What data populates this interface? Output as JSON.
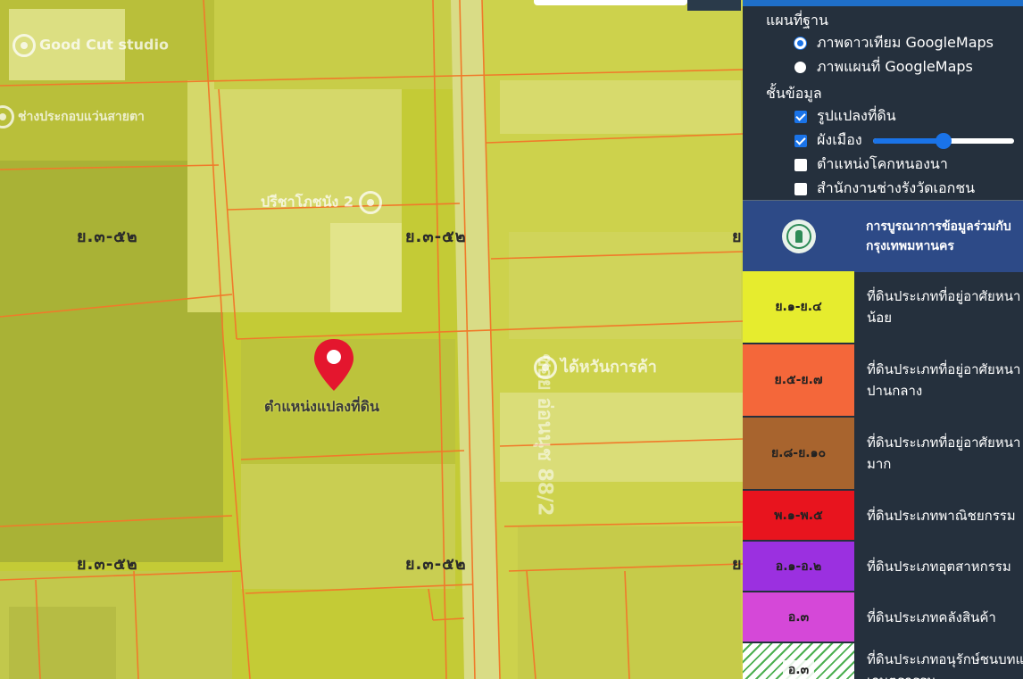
{
  "map": {
    "zone_labels": [
      "ย.๓-๕๒",
      "ย.๓-๕๒",
      "ย.๓-๕๒",
      "ย.๓-๕๒",
      "ย",
      "ย"
    ],
    "pois": [
      "Good Cut studio",
      "ช่างประกอบแว่นสายตา",
      "ปรีชาโภชนัง 2",
      "ได้หวันการค้า"
    ],
    "road_label": "ซอย อ่อนนุช 88/2",
    "pin_label": "ตำแหน่งแปลงที่ดิน"
  },
  "panel": {
    "basemap_title": "แผนที่ฐาน",
    "basemap_options": [
      {
        "label": "ภาพดาวเทียม GoogleMaps",
        "selected": true
      },
      {
        "label": "ภาพแผนที่ GoogleMaps",
        "selected": false
      }
    ],
    "layers_title": "ชั้นข้อมูล",
    "layers": [
      {
        "label": "รูปแปลงที่ดิน",
        "checked": true
      },
      {
        "label": "ผังเมือง",
        "checked": true,
        "opacity": 0.5
      },
      {
        "label": "ตำแหน่งโคกหนองนา",
        "checked": false
      },
      {
        "label": "สำนักงานช่างรังวัดเอกชน",
        "checked": false
      }
    ],
    "banner": {
      "line1": "การบูรณาการข้อมูลร่วมกับ",
      "line2": "กรุงเทพมหานคร"
    },
    "legend": [
      {
        "code": "ย.๑-ย.๔",
        "line1": "ที่ดินประเภทที่อยู่อาศัยหนา",
        "line2": "น้อย",
        "color": "#e6ec2e"
      },
      {
        "code": "ย.๕-ย.๗",
        "line1": "ที่ดินประเภทที่อยู่อาศัยหนา",
        "line2": "ปานกลาง",
        "color": "#f4673a"
      },
      {
        "code": "ย.๘-ย.๑๐",
        "line1": "ที่ดินประเภทที่อยู่อาศัยหนา",
        "line2": "มาก",
        "color": "#a8642e"
      },
      {
        "code": "พ.๑-พ.๕",
        "line1": "ที่ดินประเภทพาณิชยกรรม",
        "line2": "",
        "color": "#e8141e"
      },
      {
        "code": "อ.๑-อ.๒",
        "line1": "ที่ดินประเภทอุตสาหกรรม",
        "line2": "",
        "color": "#9b30e0"
      },
      {
        "code": "อ.๓",
        "line1": "ที่ดินประเภทคลังสินค้า",
        "line2": "",
        "color": "#d548d8"
      },
      {
        "code": "อ.๓",
        "line1": "ที่ดินประเภทอนุรักษ์ชนบทแ",
        "line2": "เกษตรกรรม",
        "color": "hatch"
      }
    ]
  }
}
